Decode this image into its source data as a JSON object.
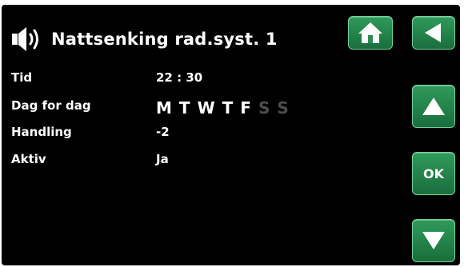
{
  "header": {
    "title": "Nattsenking rad.syst. 1",
    "icons": [
      "speaker-icon",
      "home-icon",
      "back-arrow-icon"
    ]
  },
  "buttons": {
    "ok_label": "OK",
    "icons": [
      "up-arrow-icon",
      "down-arrow-icon"
    ]
  },
  "rows": {
    "tid": {
      "label": "Tid",
      "value": "22 : 30"
    },
    "dag": {
      "label": "Dag for dag",
      "days": [
        {
          "letter": "M",
          "active": true
        },
        {
          "letter": "T",
          "active": true
        },
        {
          "letter": "W",
          "active": true
        },
        {
          "letter": "T",
          "active": true
        },
        {
          "letter": "F",
          "active": true
        },
        {
          "letter": "S",
          "active": false
        },
        {
          "letter": "S",
          "active": false
        }
      ]
    },
    "handling": {
      "label": "Handling",
      "value": "-2"
    },
    "aktiv": {
      "label": "Aktiv",
      "value": "Ja"
    }
  },
  "colors": {
    "background": "#000000",
    "button_green": "#2f9a5a",
    "text": "#ffffff",
    "inactive_day": "#4d4d4d"
  }
}
